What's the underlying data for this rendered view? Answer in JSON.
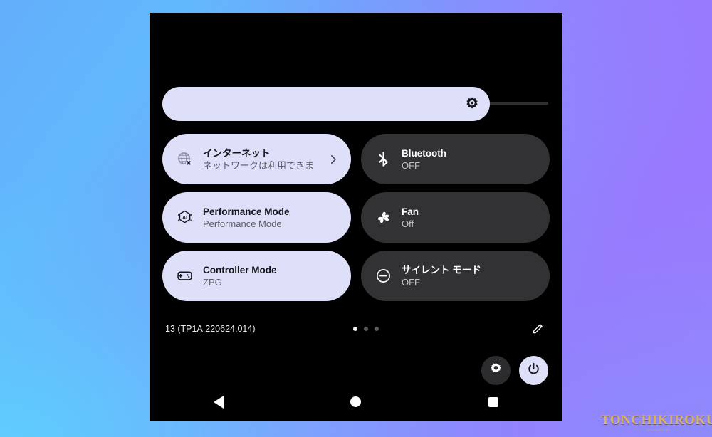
{
  "wallpaper": {
    "gradient_start": "#63ADFB",
    "gradient_mid": "#5ECEFD",
    "gradient_end": "#9878FE",
    "gradient_corner_br": "#8C8CFB"
  },
  "phone": {
    "panel_background": "#000000",
    "tile_on_color": "#DEE0FA",
    "tile_off_color": "#323234"
  },
  "brightness": {
    "icon": "brightness-sun-icon",
    "fill_percent": 85,
    "label": "Brightness"
  },
  "tiles": [
    {
      "name": "internet",
      "icon": "globe-off-icon",
      "title": "インターネット",
      "subtitle": "ネットワークは利用できま",
      "state": "on",
      "has_chevron": true,
      "chevron_icon": "chevron-right-icon"
    },
    {
      "name": "bluetooth",
      "icon": "bluetooth-icon",
      "title": "Bluetooth",
      "subtitle": "OFF",
      "state": "off",
      "has_chevron": false
    },
    {
      "name": "performance-mode",
      "icon": "ai-hexagon-icon",
      "title": "Performance Mode",
      "subtitle": "Performance Mode",
      "state": "on",
      "has_chevron": false
    },
    {
      "name": "fan",
      "icon": "fan-icon",
      "title": "Fan",
      "subtitle": "Off",
      "state": "off",
      "has_chevron": false
    },
    {
      "name": "controller-mode",
      "icon": "gamepad-icon",
      "title": "Controller Mode",
      "subtitle": "ZPG",
      "state": "on",
      "has_chevron": false
    },
    {
      "name": "silent-mode",
      "icon": "do-not-disturb-icon",
      "title": "サイレント モード",
      "subtitle": "OFF",
      "state": "off",
      "has_chevron": false
    }
  ],
  "footer": {
    "build_label": "13 (TP1A.220624.014)",
    "page_dots": {
      "total": 3,
      "active_index": 0
    },
    "edit_icon": "pencil-edit-icon"
  },
  "actions": {
    "settings_icon": "gear-icon",
    "power_icon": "power-icon"
  },
  "navbar": {
    "back_icon": "triangle-back-icon",
    "home_icon": "circle-home-icon",
    "recents_icon": "square-recents-icon"
  },
  "watermark": {
    "text": "TONCHIKIROKU",
    "subtext": "tonchikiroku.com",
    "color": "#d8b26a"
  }
}
